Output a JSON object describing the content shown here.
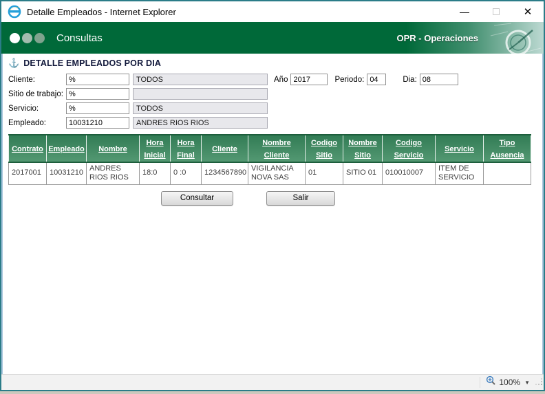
{
  "window": {
    "title": "Detalle Empleados - Internet Explorer",
    "controls": {
      "minimize_glyph": "—",
      "close_glyph": "✕"
    }
  },
  "banner": {
    "title": "Consultas",
    "right_label": "OPR - Operaciones"
  },
  "icons": {
    "anchor": "⚓",
    "zoom_dropdown": "▼"
  },
  "page": {
    "heading": "DETALLE EMPLEADOS POR DIA",
    "form": {
      "rows": [
        {
          "label": "Cliente:",
          "value": "%",
          "display": "TODOS"
        },
        {
          "label": "Sitio de trabajo:",
          "value": "%",
          "display": ""
        },
        {
          "label": "Servicio:",
          "value": "%",
          "display": "TODOS"
        },
        {
          "label": "Empleado:",
          "value": "10031210",
          "display": "ANDRES RIOS RIOS"
        }
      ],
      "date_fields": [
        {
          "label": "Año",
          "value": "2017"
        },
        {
          "label": "Periodo:",
          "value": "04"
        },
        {
          "label": "Dia:",
          "value": "08"
        }
      ]
    },
    "table": {
      "headers": [
        "Contrato",
        "Empleado",
        "Nombre",
        "Hora Inicial",
        "Hora Final",
        "Cliente",
        "Nombre Cliente",
        "Codigo Sitio",
        "Nombre Sitio",
        "Codigo Servicio",
        "Servicio",
        "Tipo Ausencia"
      ],
      "rows": [
        [
          "2017001",
          "10031210",
          "ANDRES RIOS RIOS",
          "18:0",
          "0 :0",
          "1234567890",
          "VIGILANCIA NOVA SAS",
          "01",
          "SITIO 01",
          "010010007",
          "ITEM DE SERVICIO",
          ""
        ]
      ]
    },
    "buttons": {
      "consultar": "Consultar",
      "salir": "Salir"
    }
  },
  "statusbar": {
    "zoom": "100%"
  },
  "colors": {
    "banner_green": "#006939",
    "table_header_green": "#3f8a60",
    "window_border_teal": "#2b7c88",
    "readonly_field_bg": "#e8e8ec"
  }
}
